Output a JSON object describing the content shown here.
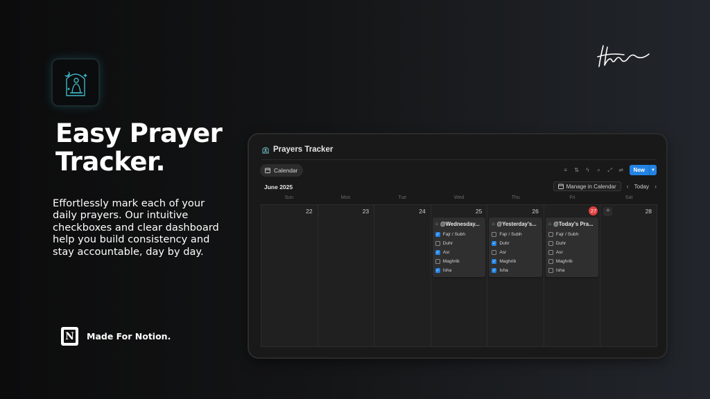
{
  "hero": {
    "title": "Easy Prayer Tracker.",
    "description": "Effortlessly mark each of your daily prayers. Our intuitive checkboxes and clear dashboard help you build consistency and stay accountable, day by day.",
    "badge_label": "Made For Notion."
  },
  "window": {
    "title": "Prayers Tracker",
    "view_tab_label": "Calendar",
    "new_button_label": "New",
    "month_label": "June 2025",
    "manage_button_label": "Manage in Calendar",
    "today_button_label": "Today",
    "toolbar_icons": [
      "filter-icon",
      "sort-icon",
      "automation-icon",
      "search-icon",
      "expand-icon",
      "settings-icon"
    ],
    "accent_color": "#2383e2",
    "today_color": "#e03e3e"
  },
  "calendar": {
    "weekdays": [
      "Sun",
      "Mon",
      "Tue",
      "Wed",
      "Thu",
      "Fri",
      "Sat"
    ],
    "days": [
      {
        "num": "22",
        "today": false
      },
      {
        "num": "23",
        "today": false
      },
      {
        "num": "24",
        "today": false
      },
      {
        "num": "25",
        "today": false
      },
      {
        "num": "26",
        "today": false
      },
      {
        "num": "27",
        "today": true
      },
      {
        "num": "28",
        "today": false
      }
    ],
    "cards": [
      {
        "day_index": 3,
        "title": "@Wednesday...",
        "items": [
          {
            "label": "Fajr / Subh",
            "checked": true
          },
          {
            "label": "Duhr",
            "checked": false
          },
          {
            "label": "Asr",
            "checked": true
          },
          {
            "label": "Maghrib",
            "checked": false
          },
          {
            "label": "Isha",
            "checked": true
          }
        ]
      },
      {
        "day_index": 4,
        "title": "@Yesterday's...",
        "items": [
          {
            "label": "Fajr / Subh",
            "checked": false
          },
          {
            "label": "Duhr",
            "checked": true
          },
          {
            "label": "Asr",
            "checked": false
          },
          {
            "label": "Maghrib",
            "checked": true
          },
          {
            "label": "Isha",
            "checked": true
          }
        ]
      },
      {
        "day_index": 5,
        "title": "@Today's Pra...",
        "items": [
          {
            "label": "Fajr / Subh",
            "checked": false
          },
          {
            "label": "Duhr",
            "checked": false
          },
          {
            "label": "Asr",
            "checked": false
          },
          {
            "label": "Maghrib",
            "checked": false
          },
          {
            "label": "Isha",
            "checked": false
          }
        ]
      }
    ]
  }
}
